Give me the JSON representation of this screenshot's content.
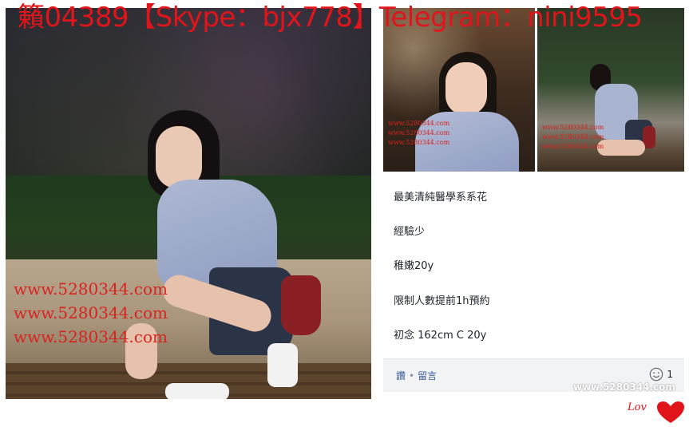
{
  "headline": "籟04389【Skype：bjx778】Telegram：nini9595",
  "main_photo": {
    "watermarks": [
      "www.5280344.com",
      "www.5280344.com",
      "www.5280344.com"
    ]
  },
  "thumbnails": [
    {
      "watermarks": [
        "www.5280344.com",
        "www.5280344.com",
        "www.5280344.com"
      ]
    },
    {
      "watermarks": [
        "www.5280344.com",
        "www.5280344.com",
        "www.5280344.com"
      ]
    }
  ],
  "post": {
    "lines": [
      "最美清純醫學系系花",
      "經驗少",
      "稚嫩20y",
      "限制人數提前1h預約",
      "初念 162cm C 20y"
    ],
    "footer": {
      "like_label": "讚",
      "comment_label": "留言",
      "reaction_count": "1"
    }
  },
  "corner": {
    "site_watermark": "www.5280344.com",
    "sign": "Lov"
  },
  "colors": {
    "headline_red": "#e0141a",
    "watermark_red": "#d8231f",
    "link_blue": "#365899",
    "footer_bg": "#f2f3f5"
  },
  "icons": [
    "smile-reaction-icon",
    "heart-icon"
  ]
}
